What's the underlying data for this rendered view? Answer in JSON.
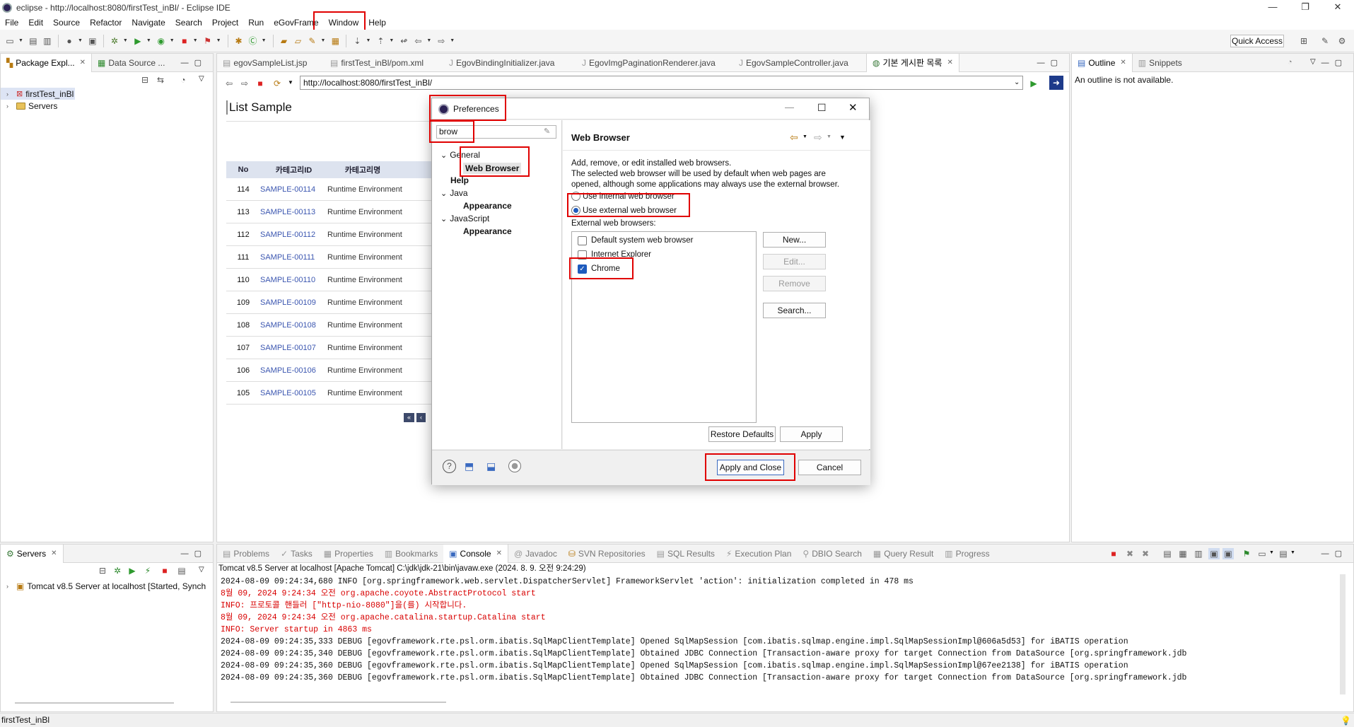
{
  "window": {
    "title": "eclipse - http://localhost:8080/firstTest_inBl/ - Eclipse IDE",
    "minimize": "—",
    "restore": "❐",
    "close": "✕"
  },
  "menu": [
    "File",
    "Edit",
    "Source",
    "Refactor",
    "Navigate",
    "Search",
    "Project",
    "Run",
    "eGovFrame",
    "Window",
    "Help"
  ],
  "toolbar": {
    "quick_access": "Quick Access"
  },
  "left_pane": {
    "tabs": [
      "Package Expl...",
      "Data Source ..."
    ],
    "tree": [
      "firstTest_inBl",
      "Servers"
    ]
  },
  "editor": {
    "tabs": [
      "egovSampleList.jsp",
      "firstTest_inBl/pom.xml",
      "EgovBindingInitializer.java",
      "EgovImgPaginationRenderer.java",
      "EgovSampleController.java",
      "기본 게시판 목록"
    ],
    "url": "http://localhost:8080/firstTest_inBl/",
    "page_title": "List Sample",
    "table_headers": [
      "No",
      "카테고리ID",
      "카테고리명"
    ],
    "rows": [
      [
        "114",
        "SAMPLE-00114",
        "Runtime Environment"
      ],
      [
        "113",
        "SAMPLE-00113",
        "Runtime Environment"
      ],
      [
        "112",
        "SAMPLE-00112",
        "Runtime Environment"
      ],
      [
        "111",
        "SAMPLE-00111",
        "Runtime Environment"
      ],
      [
        "110",
        "SAMPLE-00110",
        "Runtime Environment"
      ],
      [
        "109",
        "SAMPLE-00109",
        "Runtime Environment"
      ],
      [
        "108",
        "SAMPLE-00108",
        "Runtime Environment"
      ],
      [
        "107",
        "SAMPLE-00107",
        "Runtime Environment"
      ],
      [
        "106",
        "SAMPLE-00106",
        "Runtime Environment"
      ],
      [
        "105",
        "SAMPLE-00105",
        "Runtime Environment"
      ]
    ]
  },
  "right_pane": {
    "tabs": [
      "Outline",
      "Snippets"
    ],
    "message": "An outline is not available."
  },
  "dialog": {
    "title": "Preferences",
    "filter": "brow",
    "tree": [
      {
        "label": "General",
        "bold": false,
        "level": 0,
        "twisty": true
      },
      {
        "label": "Web Browser",
        "bold": true,
        "level": 1,
        "twisty": false
      },
      {
        "label": "Help",
        "bold": true,
        "level": 0,
        "twisty": false
      },
      {
        "label": "Java",
        "bold": false,
        "level": 0,
        "twisty": true
      },
      {
        "label": "Appearance",
        "bold": true,
        "level": 1,
        "twisty": false
      },
      {
        "label": "JavaScript",
        "bold": false,
        "level": 0,
        "twisty": true
      },
      {
        "label": "Appearance",
        "bold": true,
        "level": 1,
        "twisty": false
      }
    ],
    "page_title": "Web Browser",
    "description": [
      "Add, remove, or edit installed web browsers.",
      "The selected web browser will be used by default when web pages are",
      "opened, although some applications may always use the external browser."
    ],
    "radio_internal": "Use internal web browser",
    "radio_external": "Use external web browser",
    "external_label": "External web browsers:",
    "browsers": [
      {
        "name": "Default system web browser",
        "checked": false
      },
      {
        "name": "Internet Explorer",
        "checked": false
      },
      {
        "name": "Chrome",
        "checked": true
      }
    ],
    "buttons": {
      "new": "New...",
      "edit": "Edit...",
      "remove": "Remove",
      "search": "Search...",
      "restore": "Restore Defaults",
      "apply": "Apply",
      "apply_close": "Apply and Close",
      "cancel": "Cancel"
    }
  },
  "servers_pane": {
    "tab": "Servers",
    "item": "Tomcat v8.5 Server at localhost  [Started, Synch"
  },
  "console": {
    "tabs": [
      "Problems",
      "Tasks",
      "Properties",
      "Bookmarks",
      "Console",
      "Javadoc",
      "SVN Repositories",
      "SQL Results",
      "Execution Plan",
      "DBIO Search",
      "Query Result",
      "Progress"
    ],
    "header": "Tomcat v8.5 Server at localhost [Apache Tomcat] C:\\jdk\\jdk-21\\bin\\javaw.exe  (2024. 8. 9. 오전 9:24:29)",
    "lines": [
      {
        "text": "2024-08-09 09:24:34,680  INFO [org.springframework.web.servlet.DispatcherServlet] FrameworkServlet 'action': initialization completed in 478 ms",
        "red": false
      },
      {
        "text": "8월 09, 2024 9:24:34 오전 org.apache.coyote.AbstractProtocol start",
        "red": true
      },
      {
        "text": "INFO: 프로토콜 핸들러 [\"http-nio-8080\"]을(를) 시작합니다.",
        "red": true
      },
      {
        "text": "8월 09, 2024 9:24:34 오전 org.apache.catalina.startup.Catalina start",
        "red": true
      },
      {
        "text": "INFO: Server startup in 4863 ms",
        "red": true
      },
      {
        "text": "2024-08-09 09:24:35,333 DEBUG [egovframework.rte.psl.orm.ibatis.SqlMapClientTemplate] Opened SqlMapSession [com.ibatis.sqlmap.engine.impl.SqlMapSessionImpl@606a5d53] for iBATIS operation",
        "red": false
      },
      {
        "text": "2024-08-09 09:24:35,340 DEBUG [egovframework.rte.psl.orm.ibatis.SqlMapClientTemplate] Obtained JDBC Connection [Transaction-aware proxy for target Connection  from DataSource [org.springframework.jdb",
        "red": false
      },
      {
        "text": "2024-08-09 09:24:35,360 DEBUG [egovframework.rte.psl.orm.ibatis.SqlMapClientTemplate] Opened SqlMapSession [com.ibatis.sqlmap.engine.impl.SqlMapSessionImpl@67ee2138] for iBATIS operation",
        "red": false
      },
      {
        "text": "2024-08-09 09:24:35,360 DEBUG [egovframework.rte.psl.orm.ibatis.SqlMapClientTemplate] Obtained JDBC Connection [Transaction-aware proxy for target Connection  from DataSource [org.springframework.jdb",
        "red": false
      }
    ]
  },
  "status_bar": {
    "text": "firstTest_inBl"
  }
}
